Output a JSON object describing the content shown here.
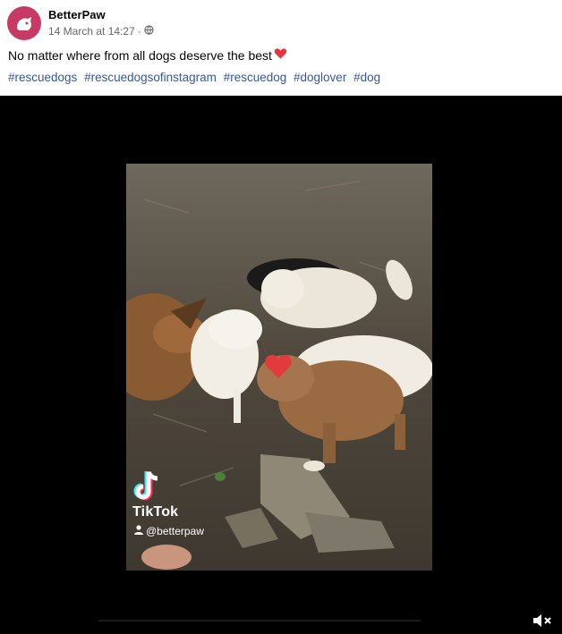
{
  "post": {
    "author": "BetterPaw",
    "timestamp": "14 March at 14:27",
    "separator": "·",
    "caption": "No matter where from all dogs deserve the best",
    "hashtags": [
      "#rescuedogs",
      "#rescuedogsofinstagram",
      "#rescuedog",
      "#doglover",
      "#dog"
    ]
  },
  "video": {
    "watermark_brand": "TikTok",
    "watermark_handle": "@betterpaw"
  },
  "icons": {
    "avatar": "paw-logo-icon",
    "audience": "globe-icon",
    "caption_emoji": "red-heart-icon",
    "handle": "user-icon",
    "mute": "volume-muted-icon"
  },
  "colors": {
    "brand_avatar": "#c73a63",
    "hashtag": "#385898",
    "video_bg": "#000000"
  }
}
